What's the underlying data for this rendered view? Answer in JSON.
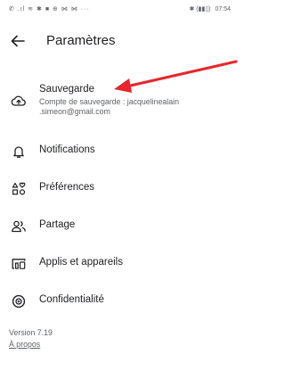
{
  "status_bar": {
    "left_icons": "✆ .ıl ≋ ✱ ■ ⊕ ⋈ ⋈ ···",
    "battery": "(▮▮▯)",
    "time": "07:54"
  },
  "header": {
    "title": "Paramètres"
  },
  "menu": {
    "backup": {
      "label": "Sauvegarde",
      "subtitle": "Compte de sauvegarde : jacquelinealain .simeon@gmail.com"
    },
    "notifications": {
      "label": "Notifications"
    },
    "preferences": {
      "label": "Préférences"
    },
    "sharing": {
      "label": "Partage"
    },
    "apps": {
      "label": "Applis et appareils"
    },
    "privacy": {
      "label": "Confidentialité"
    }
  },
  "footer": {
    "version": "Version 7.19",
    "about_label": "À propos"
  },
  "colors": {
    "annotation_arrow": "#e8262b",
    "text_primary": "#202124",
    "text_secondary": "#5f6368"
  }
}
